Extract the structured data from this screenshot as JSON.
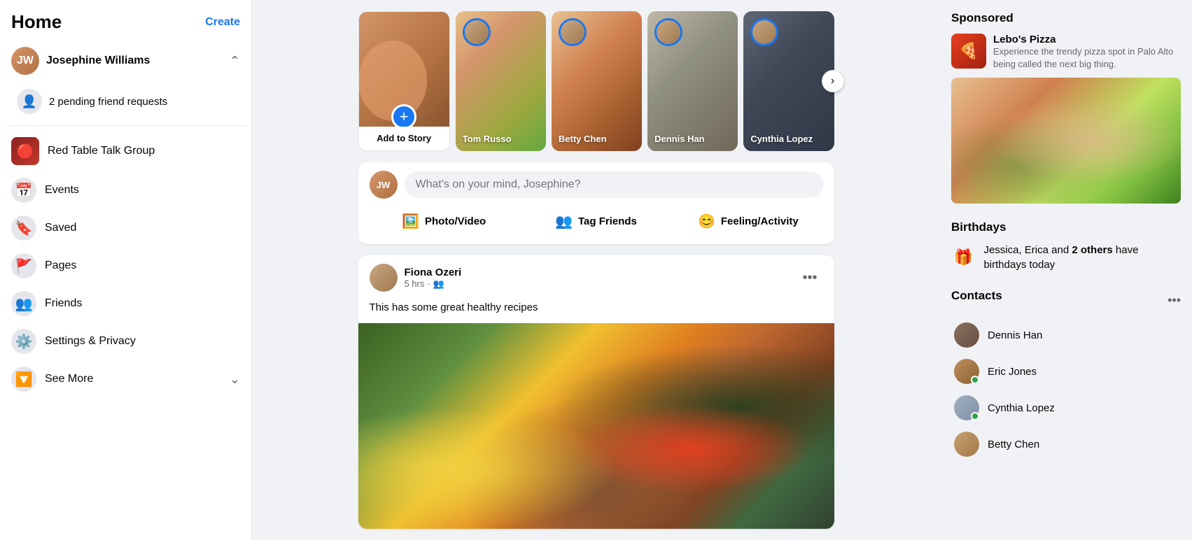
{
  "sidebar": {
    "title": "Home",
    "create_label": "Create",
    "user": {
      "name": "Josephine Williams",
      "pending_requests": "2 pending friend requests"
    },
    "items": [
      {
        "id": "red-table-talk",
        "label": "Red Table Talk Group",
        "icon": "🔴"
      },
      {
        "id": "events",
        "label": "Events",
        "icon": "📅"
      },
      {
        "id": "saved",
        "label": "Saved",
        "icon": "🔖"
      },
      {
        "id": "pages",
        "label": "Pages",
        "icon": "🚩"
      },
      {
        "id": "friends",
        "label": "Friends",
        "icon": "👥"
      },
      {
        "id": "settings",
        "label": "Settings & Privacy",
        "icon": "⚙️"
      },
      {
        "id": "see-more",
        "label": "See More",
        "icon": "🔽"
      }
    ]
  },
  "stories": {
    "add_label": "Add to Story",
    "items": [
      {
        "name": "Tom Russo",
        "bg": "story-bg-1"
      },
      {
        "name": "Betty Chen",
        "bg": "story-bg-2"
      },
      {
        "name": "Dennis Han",
        "bg": "story-bg-3"
      },
      {
        "name": "Cynthia Lopez",
        "bg": "story-bg-4"
      }
    ]
  },
  "post_box": {
    "placeholder": "What's on your mind, Josephine?",
    "actions": [
      {
        "id": "photo-video",
        "label": "Photo/Video",
        "icon": "🖼️",
        "color": "#45bd62"
      },
      {
        "id": "tag-friends",
        "label": "Tag Friends",
        "icon": "👥",
        "color": "#1877f2"
      },
      {
        "id": "feeling",
        "label": "Feeling/Activity",
        "icon": "😊",
        "color": "#f7b928"
      }
    ]
  },
  "feed": {
    "posts": [
      {
        "author": "Fiona Ozeri",
        "time": "5 hrs",
        "audience": "friends",
        "text": "This has some great healthy recipes"
      }
    ]
  },
  "right_sidebar": {
    "sponsored": {
      "title": "Sponsored",
      "name": "Lebo's Pizza",
      "description": "Experience the trendy pizza spot in Palo Alto being called the next big thing."
    },
    "birthdays": {
      "title": "Birthdays",
      "text_prefix": "Jessica, Erica",
      "text_middle": " and ",
      "text_bold": "2 others",
      "text_suffix": " have birthdays today"
    },
    "contacts": {
      "title": "Contacts",
      "items": [
        {
          "name": "Dennis Han",
          "online": false,
          "avatar_class": "contact-avatar-dennis"
        },
        {
          "name": "Eric Jones",
          "online": true,
          "avatar_class": "contact-avatar-eric"
        },
        {
          "name": "Cynthia Lopez",
          "online": true,
          "avatar_class": "contact-avatar-cynthia"
        },
        {
          "name": "Betty Chen",
          "online": false,
          "avatar_class": "contact-avatar-betty"
        }
      ]
    }
  }
}
